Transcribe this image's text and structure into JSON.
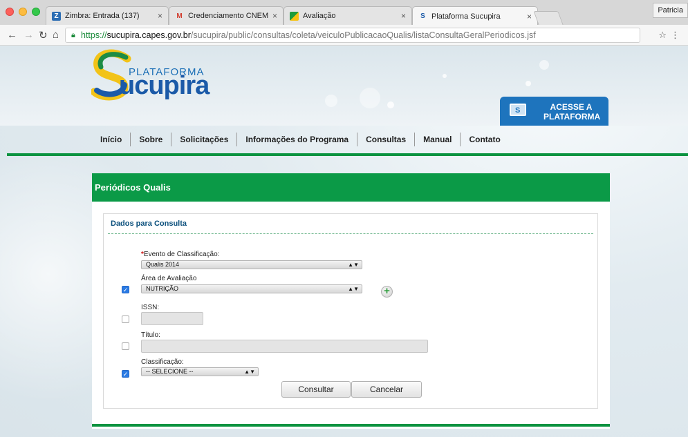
{
  "browser": {
    "tabs": [
      {
        "label": "Zimbra: Entrada (137)",
        "favicon": "zimbra-icon",
        "active": false
      },
      {
        "label": "Credenciamento CNEM - ppra",
        "favicon": "gmail-icon",
        "active": false
      },
      {
        "label": "Avaliação",
        "favicon": "avaliacao-icon",
        "active": false
      },
      {
        "label": "Plataforma Sucupira",
        "favicon": "sucupira-icon",
        "active": true
      }
    ],
    "profile": "Patricia",
    "url_scheme": "https://",
    "url_host": "sucupira.capes.gov.br",
    "url_path": "/sucupira/public/consultas/coleta/veiculoPublicacaoQualis/listaConsultaGeralPeriodicos.jsf",
    "close_glyph": "×"
  },
  "site": {
    "logo_small": "PLATAFORMA",
    "logo_big": "ucupira",
    "access_line1": "ACESSE A",
    "access_line2": "PLATAFORMA",
    "access_icon_letter": "S",
    "nav": [
      "Início",
      "Sobre",
      "Solicitações",
      "Informações do Programa",
      "Consultas",
      "Manual",
      "Contato"
    ]
  },
  "panel": {
    "title": "Periódicos Qualis",
    "fieldset_title": "Dados para Consulta",
    "evento_label": "Evento de Classificação:",
    "evento_required": "*",
    "evento_value": "Qualis 2014",
    "area_label": "Área de Avaliação",
    "area_value": "NUTRIÇÃO",
    "issn_label": "ISSN:",
    "titulo_label": "Título:",
    "classificacao_label": "Classificação:",
    "classificacao_value": "-- SELECIONE --",
    "consultar": "Consultar",
    "cancelar": "Cancelar",
    "plus_glyph": "+",
    "check_glyph": "✓",
    "select_arrow": "▲▼",
    "area_checked": true,
    "issn_checked": false,
    "titulo_checked": false,
    "classificacao_checked": true
  }
}
